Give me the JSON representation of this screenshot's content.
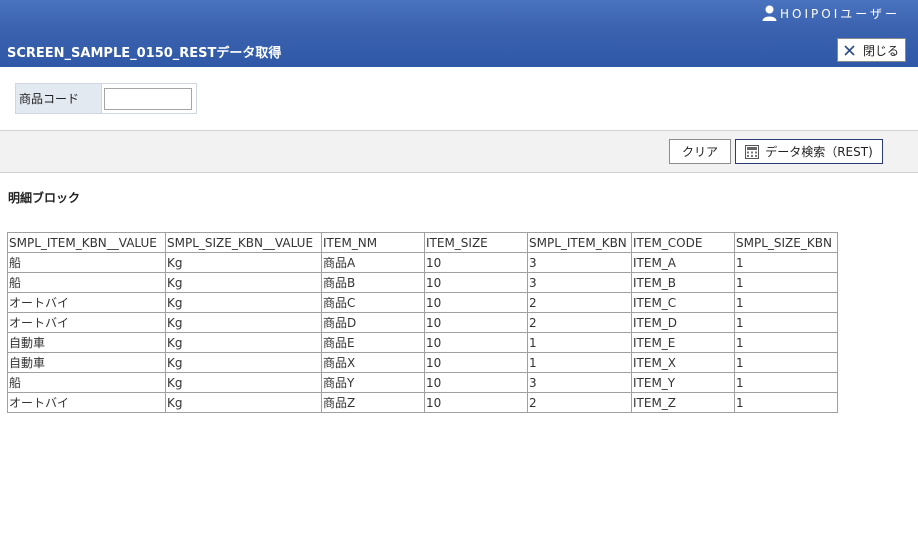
{
  "header": {
    "user_name": "HOIPOIユーザー",
    "title": "SCREEN_SAMPLE_0150_RESTデータ取得",
    "close_label": "閉じる"
  },
  "search": {
    "label": "商品コード",
    "value": ""
  },
  "buttons": {
    "clear_label": "クリア",
    "search_label": "データ検索（REST)"
  },
  "detail": {
    "block_title": "明細ブロック",
    "columns": [
      "SMPL_ITEM_KBN__VALUE",
      "SMPL_SIZE_KBN__VALUE",
      "ITEM_NM",
      "ITEM_SIZE",
      "SMPL_ITEM_KBN",
      "ITEM_CODE",
      "SMPL_SIZE_KBN"
    ],
    "rows": [
      [
        "船",
        "Kg",
        "商品A",
        "10",
        "3",
        "ITEM_A",
        "1"
      ],
      [
        "船",
        "Kg",
        "商品B",
        "10",
        "3",
        "ITEM_B",
        "1"
      ],
      [
        "オートバイ",
        "Kg",
        "商品C",
        "10",
        "2",
        "ITEM_C",
        "1"
      ],
      [
        "オートバイ",
        "Kg",
        "商品D",
        "10",
        "2",
        "ITEM_D",
        "1"
      ],
      [
        "自動車",
        "Kg",
        "商品E",
        "10",
        "1",
        "ITEM_E",
        "1"
      ],
      [
        "自動車",
        "Kg",
        "商品X",
        "10",
        "1",
        "ITEM_X",
        "1"
      ],
      [
        "船",
        "Kg",
        "商品Y",
        "10",
        "3",
        "ITEM_Y",
        "1"
      ],
      [
        "オートバイ",
        "Kg",
        "商品Z",
        "10",
        "2",
        "ITEM_Z",
        "1"
      ]
    ]
  },
  "colors": {
    "header_bg": "#3b63b0",
    "search_label_bg": "#e3e9f1",
    "button_bar_bg": "#f2f2f2",
    "search_button_border": "#2b3a78"
  },
  "icons": {
    "user": "user-icon",
    "close": "close-icon",
    "search": "calculator-icon"
  }
}
